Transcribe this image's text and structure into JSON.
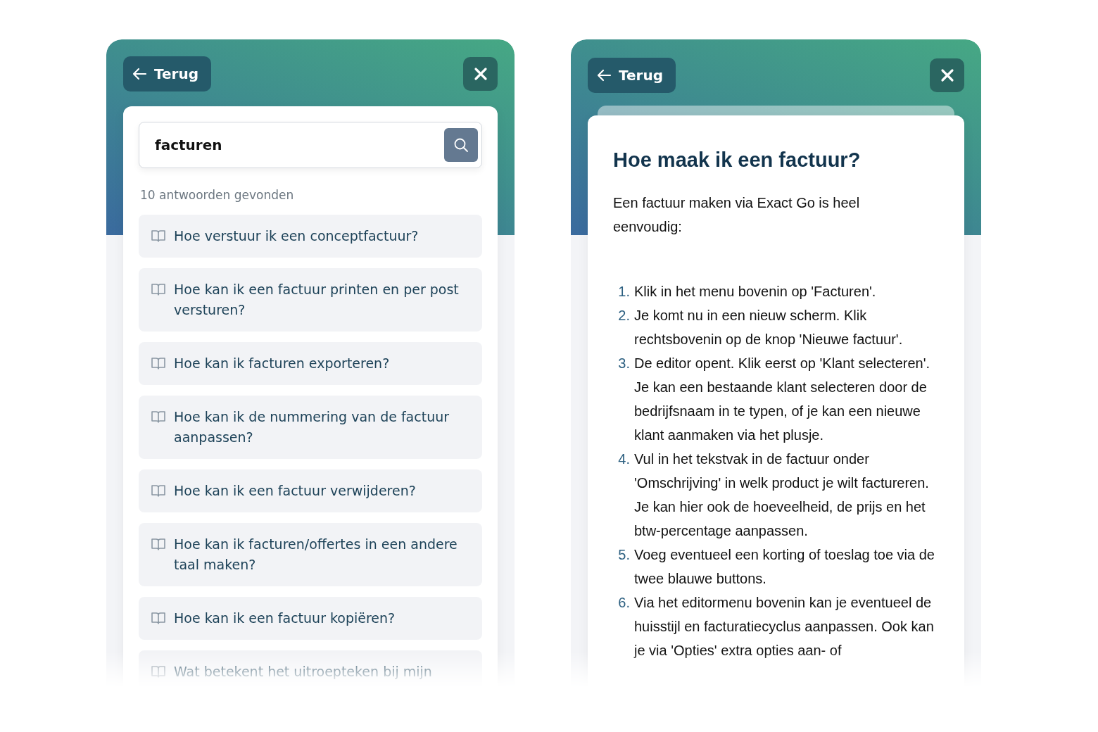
{
  "panels": [
    {
      "kind": "search",
      "back_label": "Terug",
      "search": {
        "value": "facturen"
      },
      "result_count": "10 antwoorden gevonden",
      "results": [
        "Hoe verstuur ik een conceptfactuur?",
        "Hoe kan ik een factuur printen en per post versturen?",
        "Hoe kan ik facturen exporteren?",
        "Hoe kan ik de nummering van de factuur aanpassen?",
        "Hoe kan ik een factuur verwijderen?",
        "Hoe kan ik facturen/offertes in een andere taal maken?",
        "Hoe kan ik een factuur kopiëren?",
        "Wat betekent het uitroepteken bij mijn"
      ]
    },
    {
      "kind": "article",
      "back_label": "Terug",
      "title": "Hoe maak ik een factuur?",
      "intro": "Een factuur maken via Exact Go is heel eenvoudig:",
      "steps": [
        {
          "number": "1.",
          "text": "Klik in het menu bovenin op 'Facturen'."
        },
        {
          "number": "2.",
          "text": "Je komt nu in een nieuw scherm. Klik rechtsbovenin op de knop 'Nieuwe factuur'."
        },
        {
          "number": "3.",
          "text": "De editor opent. Klik eerst op 'Klant selecteren'. Je kan een bestaande klant selecteren door de bedrijfsnaam in te typen, of je kan een nieuwe klant aanmaken via het plusje."
        },
        {
          "number": "4.",
          "text": "Vul in het tekstvak in de factuur onder 'Omschrijving' in welk product je wilt factureren. Je kan hier ook de hoeveelheid, de prijs en het btw-percentage aanpassen."
        },
        {
          "number": "5.",
          "text": "Voeg eventueel een korting of toeslag toe via de twee blauwe buttons."
        },
        {
          "number": "6.",
          "text": "Via het editormenu bovenin kan je eventueel de huisstijl en facturatiecyclus aanpassen. Ook kan je via 'Opties' extra opties aan- of"
        }
      ]
    }
  ]
}
